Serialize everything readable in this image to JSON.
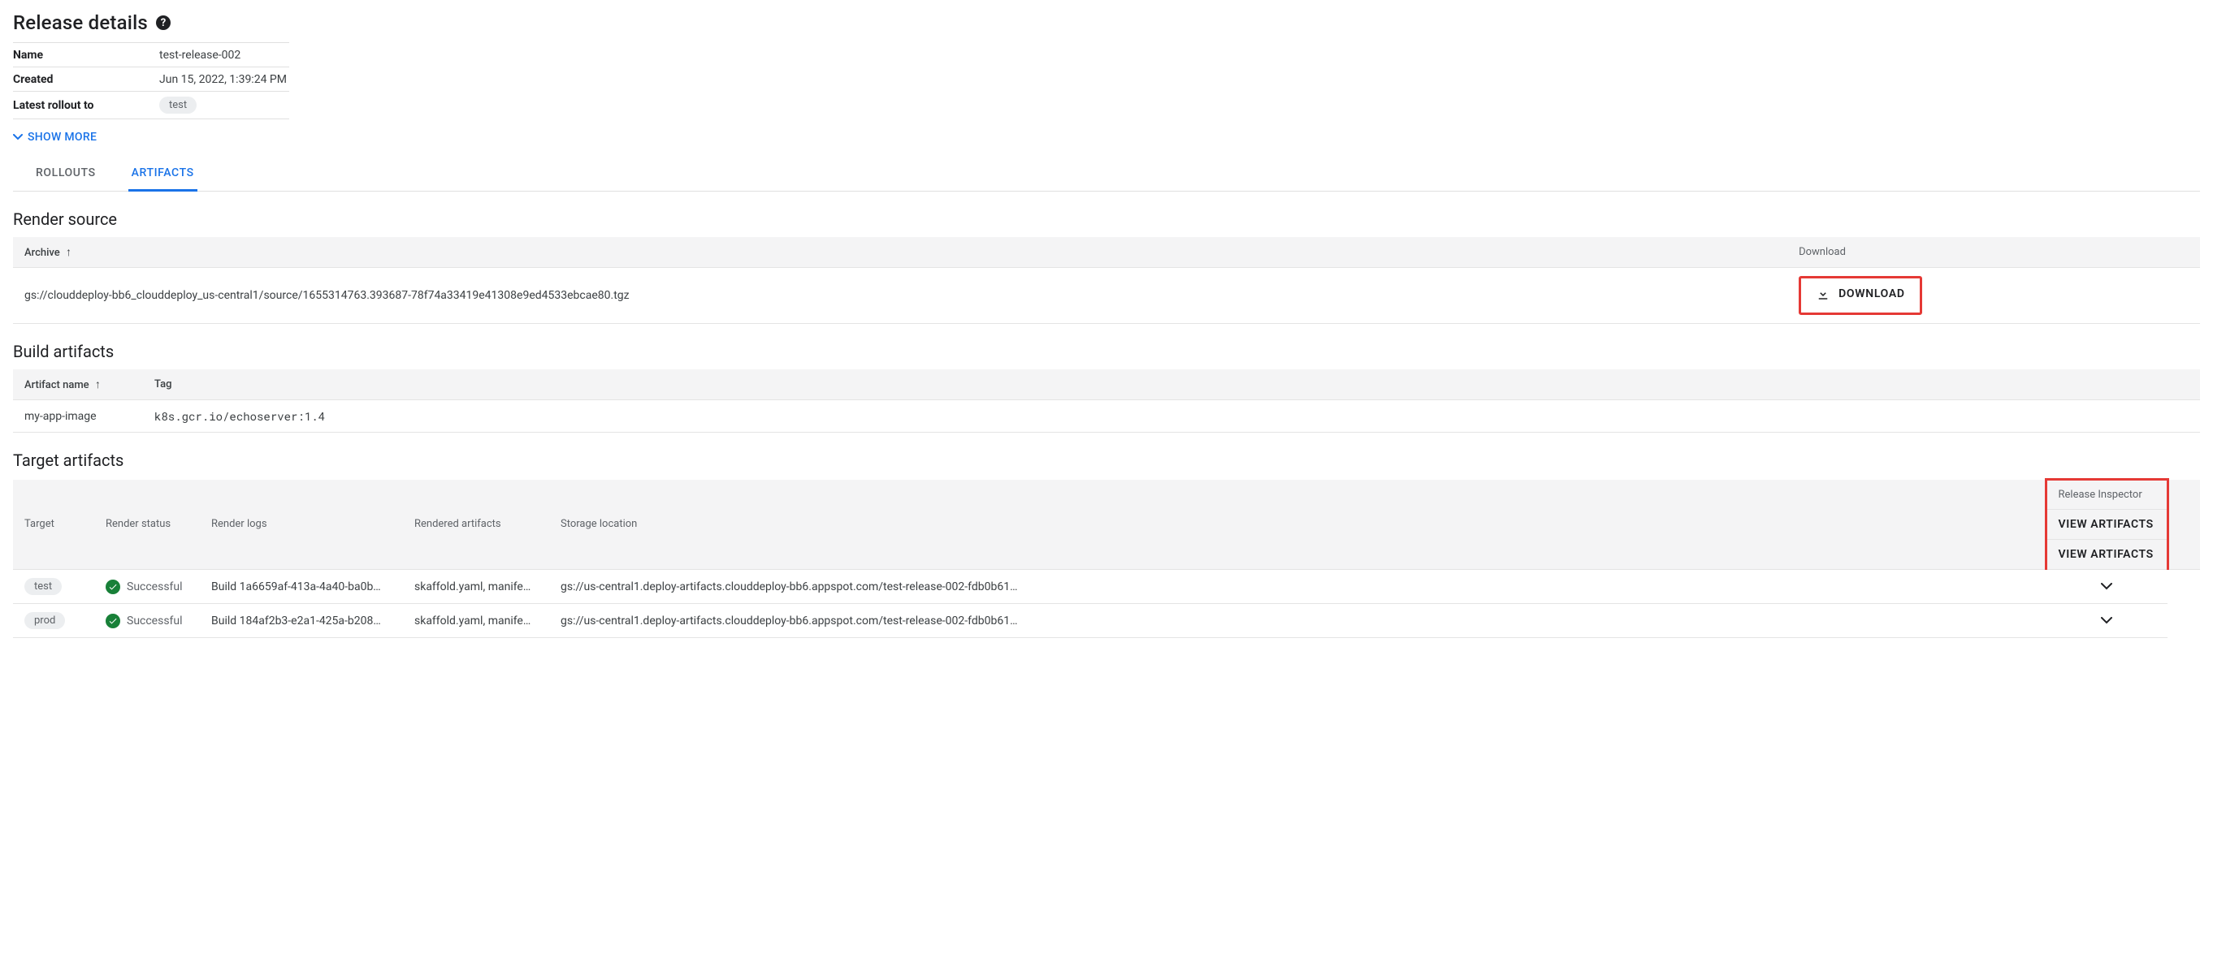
{
  "header": {
    "title": "Release details",
    "help_symbol": "?"
  },
  "details": {
    "name_label": "Name",
    "name_value": "test-release-002",
    "created_label": "Created",
    "created_value": "Jun 15, 2022, 1:39:24 PM",
    "latest_label": "Latest rollout to",
    "latest_chip": "test",
    "show_more": "SHOW MORE"
  },
  "tabs": {
    "rollouts": "ROLLOUTS",
    "artifacts": "ARTIFACTS"
  },
  "render_source": {
    "title": "Render source",
    "archive_header": "Archive",
    "download_header": "Download",
    "archive_value": "gs://clouddeploy-bb6_clouddeploy_us-central1/source/1655314763.393687-78f74a33419e41308e9ed4533ebcae80.tgz",
    "download_label": "DOWNLOAD"
  },
  "build_artifacts": {
    "title": "Build artifacts",
    "name_header": "Artifact name",
    "tag_header": "Tag",
    "rows": [
      {
        "name": "my-app-image",
        "tag": "k8s.gcr.io/echoserver:1.4"
      }
    ]
  },
  "target_artifacts": {
    "title": "Target artifacts",
    "headers": {
      "target": "Target",
      "render_status": "Render status",
      "render_logs": "Render logs",
      "rendered_artifacts": "Rendered artifacts",
      "storage_location": "Storage location",
      "release_inspector": "Release Inspector"
    },
    "view_label": "VIEW ARTIFACTS",
    "status_label": "Successful",
    "rows": [
      {
        "target": "test",
        "logs": "Build 1a6659af-413a-4a40-ba0b…",
        "rendered": "skaffold.yaml, manife…",
        "storage": "gs://us-central1.deploy-artifacts.clouddeploy-bb6.appspot.com/test-release-002-fdb0b61…"
      },
      {
        "target": "prod",
        "logs": "Build 184af2b3-e2a1-425a-b208…",
        "rendered": "skaffold.yaml, manife…",
        "storage": "gs://us-central1.deploy-artifacts.clouddeploy-bb6.appspot.com/test-release-002-fdb0b61…"
      }
    ]
  }
}
